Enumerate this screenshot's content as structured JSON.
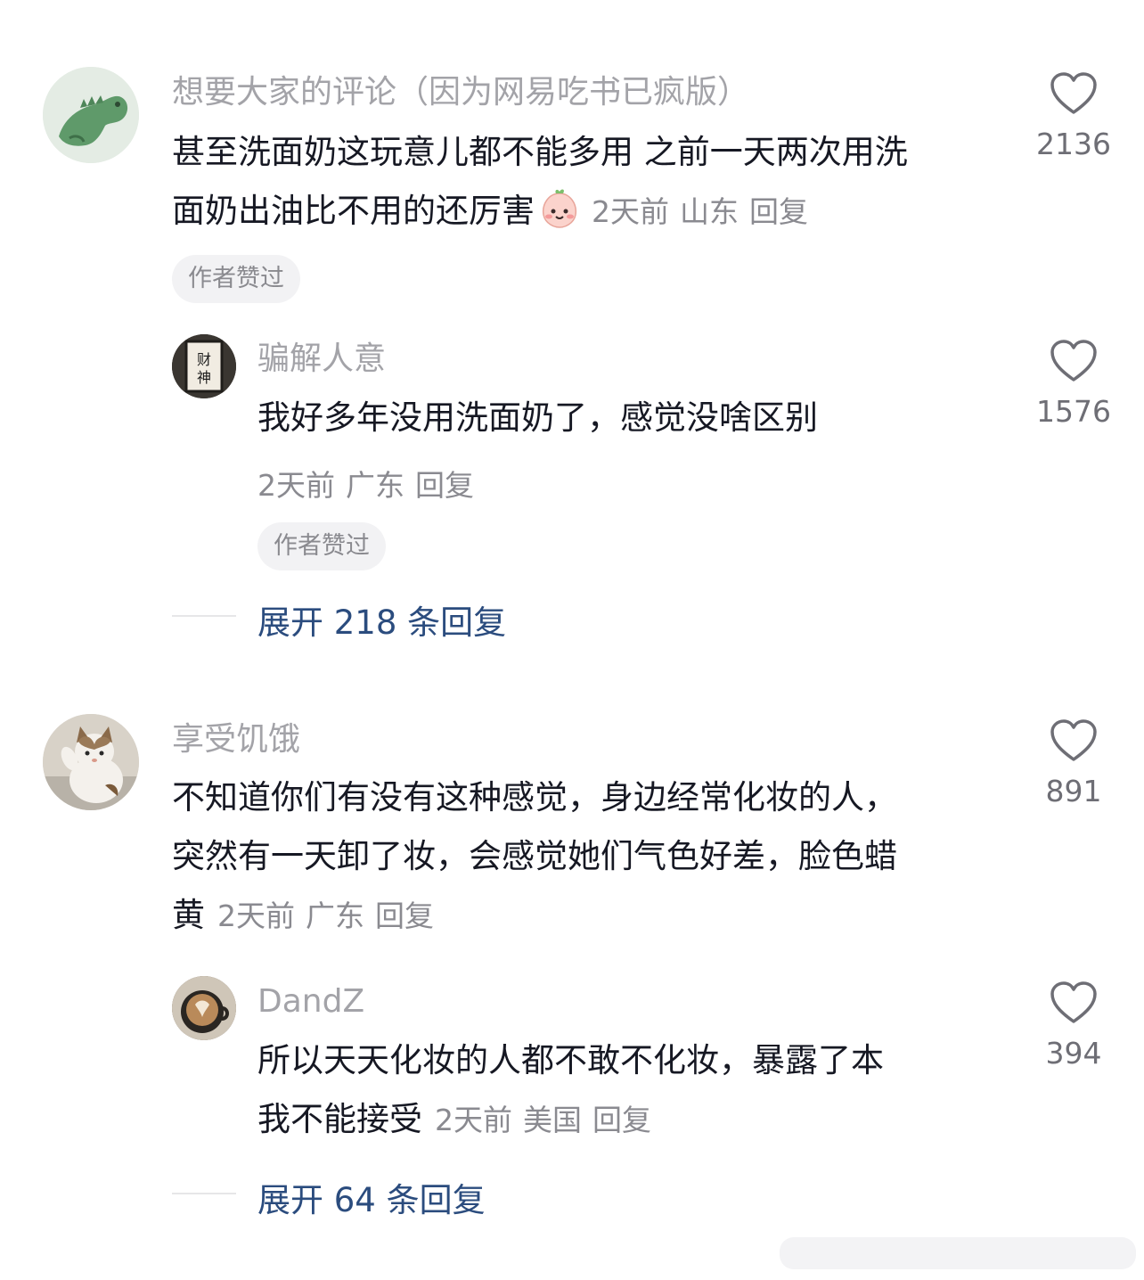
{
  "comments": [
    {
      "username": "想要大家的评论（因为网易吃书已疯版）",
      "text_line1": "甚至洗面奶这玩意儿都不能多用 之前一天两次用洗",
      "text_line2": "面奶出油比不用的还厉害",
      "emoji": "peach-smile-emoji",
      "time": "2天前",
      "location": "山东",
      "reply_label": "回复",
      "badge": "作者赞过",
      "likes": "2136",
      "avatar_icon": "green-dinosaur-avatar",
      "replies": {
        "username": "骗解人意",
        "text": "我好多年没用洗面奶了，感觉没啥区别",
        "time": "2天前",
        "location": "广东",
        "reply_label": "回复",
        "badge": "作者赞过",
        "likes": "1576",
        "avatar_icon": "calligraphy-sign-avatar",
        "avatar_text": "财神"
      },
      "expand_label": "展开 218 条回复"
    },
    {
      "username": "享受饥饿",
      "text_line1": "不知道你们有没有这种感觉，身边经常化妆的人，",
      "text_line2": "突然有一天卸了妆，会感觉她们气色好差，脸色蜡",
      "text_line3": "黄",
      "time": "2天前",
      "location": "广东",
      "reply_label": "回复",
      "likes": "891",
      "avatar_icon": "cat-photo-avatar",
      "replies": {
        "username": "DandZ",
        "text_line1": "所以天天化妆的人都不敢不化妆，暴露了本",
        "text_line2": "我不能接受",
        "time": "2天前",
        "location": "美国",
        "reply_label": "回复",
        "likes": "394",
        "avatar_icon": "latte-art-avatar"
      },
      "expand_label": "展开 64 条回复"
    }
  ],
  "colors": {
    "text": "#161823",
    "username": "#a3a3a8",
    "meta": "#8a8a90",
    "expand": "#2b4c7e",
    "badge_bg": "#f2f2f4"
  }
}
